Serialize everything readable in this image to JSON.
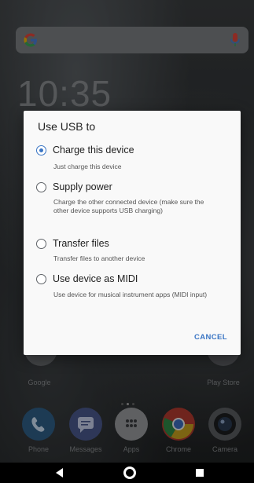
{
  "clock": "10:35",
  "dialog": {
    "title": "Use USB to",
    "options": [
      {
        "label": "Charge this device",
        "description": "Just charge this device",
        "selected": true
      },
      {
        "label": "Supply power",
        "description": "Charge the other connected device (make sure the other device supports USB charging)",
        "selected": false
      },
      {
        "label": "Transfer files",
        "description": "Transfer files to another device",
        "selected": false
      },
      {
        "label": "Use device as MIDI",
        "description": "Use device for musical instrument apps (MIDI input)",
        "selected": false
      }
    ],
    "cancel_label": "CANCEL"
  },
  "home_row": {
    "left_label": "Google",
    "right_label": "Play Store"
  },
  "dock": [
    {
      "label": "Phone",
      "icon": "phone-icon",
      "color": "#4a90c8"
    },
    {
      "label": "Messages",
      "icon": "messages-icon",
      "color": "#6a7fc4"
    },
    {
      "label": "Apps",
      "icon": "apps-grid-icon",
      "color": "#e8e8e8"
    },
    {
      "label": "Chrome",
      "icon": "chrome-icon",
      "color": "#d9473b"
    },
    {
      "label": "Camera",
      "icon": "camera-icon",
      "color": "#3a3d40"
    }
  ],
  "colors": {
    "accent": "#3a75c4",
    "dialog_bg": "#f9f9f9"
  }
}
